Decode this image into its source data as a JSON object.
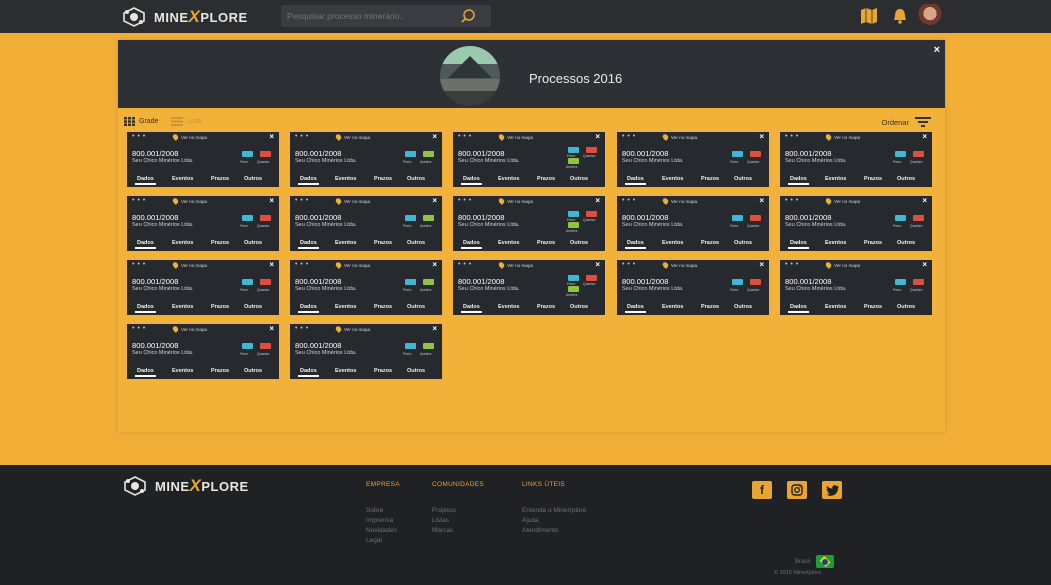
{
  "header": {
    "brand_left": "MINE",
    "brand_x": "X",
    "brand_right": "PLORE",
    "search_placeholder": "Pesquisar processo minerário.."
  },
  "panel": {
    "title": "Processos 2016",
    "close_label": "×",
    "view_grid_label": "Grade",
    "view_list_label": "Lista",
    "sort_label": "Ordenar"
  },
  "cards": [
    {
      "dots": "• • •",
      "map_label": "Ver no mapa",
      "close": "×",
      "number": "800.001/2008",
      "company": "Seu Chico Minérios Ltda.",
      "badges": [
        {
          "label": "Ferro",
          "color": "#3fb6d3"
        },
        {
          "label": "Quartzo",
          "color": "#e54b3c"
        }
      ],
      "tabs": [
        "Dados",
        "Eventos",
        "Prazos",
        "Outros"
      ]
    },
    {
      "dots": "• • •",
      "map_label": "Ver no mapa",
      "close": "×",
      "number": "800.001/2008",
      "company": "Seu Chico Minérios Ltda.",
      "badges": [
        {
          "label": "Ferro",
          "color": "#3fb6d3"
        },
        {
          "label": "Areeira",
          "color": "#8ec63f"
        }
      ],
      "tabs": [
        "Dados",
        "Eventos",
        "Prazos",
        "Outros"
      ]
    },
    {
      "dots": "• • •",
      "map_label": "Ver no mapa",
      "close": "×",
      "number": "800.001/2008",
      "company": "Seu Chico Minérios Ltda.",
      "badges": [
        {
          "label": "Ferro",
          "color": "#3fb6d3"
        },
        {
          "label": "Quartzo",
          "color": "#e54b3c"
        },
        {
          "label": "Areeira",
          "color": "#8ec63f"
        }
      ],
      "tabs": [
        "Dados",
        "Eventos",
        "Prazos",
        "Outros"
      ]
    },
    {
      "dots": "• • •",
      "map_label": "Ver no mapa",
      "close": "×",
      "number": "800.001/2008",
      "company": "Seu Chico Minérios Ltda.",
      "badges": [
        {
          "label": "Ferro",
          "color": "#3fb6d3"
        },
        {
          "label": "Quartzo",
          "color": "#e54b3c"
        }
      ],
      "tabs": [
        "Dados",
        "Eventos",
        "Prazos",
        "Outros"
      ]
    },
    {
      "dots": "• • •",
      "map_label": "Ver no mapa",
      "close": "×",
      "number": "800.001/2008",
      "company": "Seu Chico Minérios Ltda.",
      "badges": [
        {
          "label": "Ferro",
          "color": "#3fb6d3"
        },
        {
          "label": "Quartzo",
          "color": "#e54b3c"
        }
      ],
      "tabs": [
        "Dados",
        "Eventos",
        "Prazos",
        "Outros"
      ]
    },
    {
      "dots": "• • •",
      "map_label": "Ver no mapa",
      "close": "×",
      "number": "800.001/2008",
      "company": "Seu Chico Minérios Ltda.",
      "badges": [
        {
          "label": "Ferro",
          "color": "#3fb6d3"
        },
        {
          "label": "Quartzo",
          "color": "#e54b3c"
        }
      ],
      "tabs": [
        "Dados",
        "Eventos",
        "Prazos",
        "Outros"
      ]
    },
    {
      "dots": "• • •",
      "map_label": "Ver no mapa",
      "close": "×",
      "number": "800.001/2008",
      "company": "Seu Chico Minérios Ltda.",
      "badges": [
        {
          "label": "Ferro",
          "color": "#3fb6d3"
        },
        {
          "label": "Areeira",
          "color": "#8ec63f"
        }
      ],
      "tabs": [
        "Dados",
        "Eventos",
        "Prazos",
        "Outros"
      ]
    },
    {
      "dots": "• • •",
      "map_label": "Ver no mapa",
      "close": "×",
      "number": "800.001/2008",
      "company": "Seu Chico Minérios Ltda.",
      "badges": [
        {
          "label": "Ferro",
          "color": "#3fb6d3"
        },
        {
          "label": "Quartzo",
          "color": "#e54b3c"
        },
        {
          "label": "Areeira",
          "color": "#8ec63f"
        }
      ],
      "tabs": [
        "Dados",
        "Eventos",
        "Prazos",
        "Outros"
      ]
    },
    {
      "dots": "• • •",
      "map_label": "Ver no mapa",
      "close": "×",
      "number": "800.001/2008",
      "company": "Seu Chico Minérios Ltda.",
      "badges": [
        {
          "label": "Ferro",
          "color": "#3fb6d3"
        },
        {
          "label": "Quartzo",
          "color": "#e54b3c"
        }
      ],
      "tabs": [
        "Dados",
        "Eventos",
        "Prazos",
        "Outros"
      ]
    },
    {
      "dots": "• • •",
      "map_label": "Ver no mapa",
      "close": "×",
      "number": "800.001/2008",
      "company": "Seu Chico Minérios Ltda.",
      "badges": [
        {
          "label": "Ferro",
          "color": "#3fb6d3"
        },
        {
          "label": "Quartzo",
          "color": "#e54b3c"
        }
      ],
      "tabs": [
        "Dados",
        "Eventos",
        "Prazos",
        "Outros"
      ]
    },
    {
      "dots": "• • •",
      "map_label": "Ver no mapa",
      "close": "×",
      "number": "800.001/2008",
      "company": "Seu Chico Minérios Ltda.",
      "badges": [
        {
          "label": "Ferro",
          "color": "#3fb6d3"
        },
        {
          "label": "Quartzo",
          "color": "#e54b3c"
        }
      ],
      "tabs": [
        "Dados",
        "Eventos",
        "Prazos",
        "Outros"
      ]
    },
    {
      "dots": "• • •",
      "map_label": "Ver no mapa",
      "close": "×",
      "number": "800.001/2008",
      "company": "Seu Chico Minérios Ltda.",
      "badges": [
        {
          "label": "Ferro",
          "color": "#3fb6d3"
        },
        {
          "label": "Areeira",
          "color": "#8ec63f"
        }
      ],
      "tabs": [
        "Dados",
        "Eventos",
        "Prazos",
        "Outros"
      ]
    },
    {
      "dots": "• • •",
      "map_label": "Ver no mapa",
      "close": "×",
      "number": "800.001/2008",
      "company": "Seu Chico Minérios Ltda.",
      "badges": [
        {
          "label": "Ferro",
          "color": "#3fb6d3"
        },
        {
          "label": "Quartzo",
          "color": "#e54b3c"
        },
        {
          "label": "Areeira",
          "color": "#8ec63f"
        }
      ],
      "tabs": [
        "Dados",
        "Eventos",
        "Prazos",
        "Outros"
      ]
    },
    {
      "dots": "• • •",
      "map_label": "Ver no mapa",
      "close": "×",
      "number": "800.001/2008",
      "company": "Seu Chico Minérios Ltda.",
      "badges": [
        {
          "label": "Ferro",
          "color": "#3fb6d3"
        },
        {
          "label": "Quartzo",
          "color": "#e54b3c"
        }
      ],
      "tabs": [
        "Dados",
        "Eventos",
        "Prazos",
        "Outros"
      ]
    },
    {
      "dots": "• • •",
      "map_label": "Ver no mapa",
      "close": "×",
      "number": "800.001/2008",
      "company": "Seu Chico Minérios Ltda.",
      "badges": [
        {
          "label": "Ferro",
          "color": "#3fb6d3"
        },
        {
          "label": "Quartzo",
          "color": "#e54b3c"
        }
      ],
      "tabs": [
        "Dados",
        "Eventos",
        "Prazos",
        "Outros"
      ]
    },
    {
      "dots": "• • •",
      "map_label": "Ver no mapa",
      "close": "×",
      "number": "800.001/2008",
      "company": "Seu Chico Minérios Ltda.",
      "badges": [
        {
          "label": "Ferro",
          "color": "#3fb6d3"
        },
        {
          "label": "Quartzo",
          "color": "#e54b3c"
        }
      ],
      "tabs": [
        "Dados",
        "Eventos",
        "Prazos",
        "Outros"
      ]
    },
    {
      "dots": "• • •",
      "map_label": "Ver no mapa",
      "close": "×",
      "number": "800.001/2008",
      "company": "Seu Chico Minérios Ltda.",
      "badges": [
        {
          "label": "Ferro",
          "color": "#3fb6d3"
        },
        {
          "label": "Areeira",
          "color": "#8ec63f"
        }
      ],
      "tabs": [
        "Dados",
        "Eventos",
        "Prazos",
        "Outros"
      ]
    }
  ],
  "footer": {
    "brand_left": "MINE",
    "brand_x": "X",
    "brand_right": "PLORE",
    "columns": [
      {
        "heading": "EMPRESA",
        "links": [
          "Sobre",
          "Imprensa",
          "Novidades",
          "Legal"
        ]
      },
      {
        "heading": "COMUNIDADES",
        "links": [
          "Projetos",
          "Listas",
          "Marcas"
        ]
      },
      {
        "heading": "LINKS ÚTEIS",
        "links": [
          "Entenda o MineXplore",
          "Ajuda",
          "Atendimento"
        ]
      }
    ],
    "social": [
      "facebook-icon",
      "instagram-icon",
      "twitter-icon"
    ],
    "country": "Brasil",
    "copyright": "© 2016 MineXplore"
  },
  "colors": {
    "accent": "#f0ae37",
    "dark": "#26292d",
    "ferro": "#3fb6d3",
    "quartzo": "#e54b3c",
    "areeira": "#8ec63f"
  }
}
